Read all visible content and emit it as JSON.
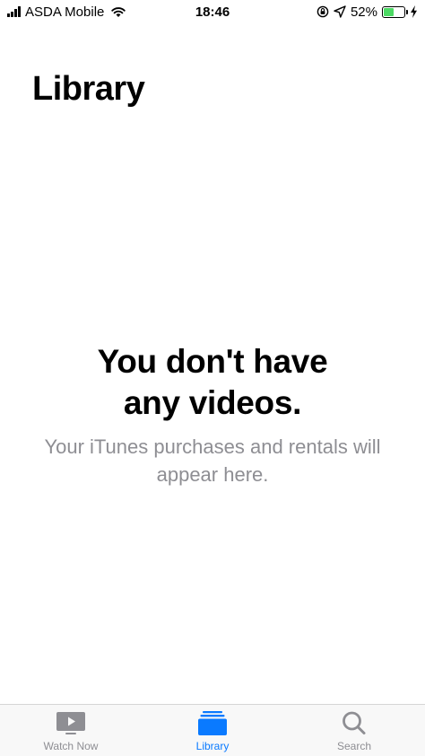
{
  "status_bar": {
    "carrier": "ASDA Mobile",
    "time": "18:46",
    "battery_percent": "52%",
    "battery_level": 0.52,
    "icons": [
      "signal-icon",
      "wifi-icon",
      "rotation-lock-icon",
      "location-icon",
      "battery-icon",
      "charging-icon"
    ]
  },
  "header": {
    "title": "Library"
  },
  "empty_state": {
    "heading": "You don't have any videos.",
    "subtitle": "Your iTunes purchases and rentals will appear here."
  },
  "tab_bar": {
    "active_tab": "Library",
    "tabs": [
      {
        "label": "Watch Now",
        "icon": "play-icon"
      },
      {
        "label": "Library",
        "icon": "library-icon"
      },
      {
        "label": "Search",
        "icon": "search-icon"
      }
    ]
  },
  "colors": {
    "accent": "#0a7aff",
    "inactive": "#8e8e93",
    "battery": "#4cd964",
    "tab_bar_bg": "#f8f8f8"
  }
}
